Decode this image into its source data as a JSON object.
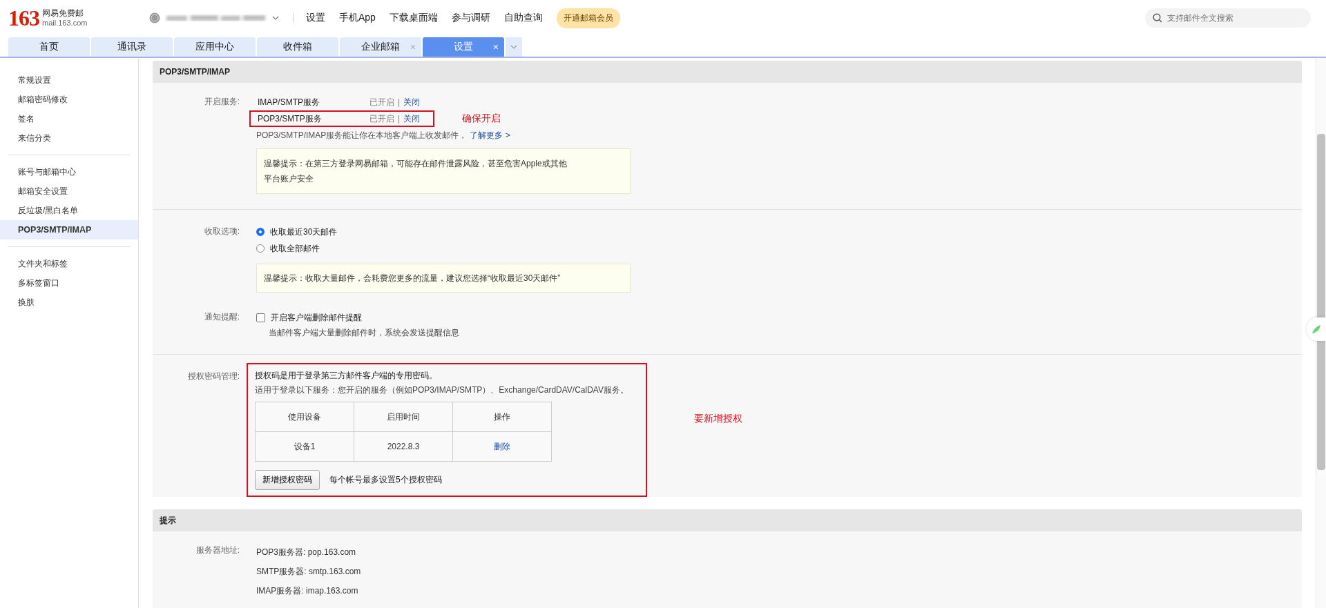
{
  "header": {
    "logo": {
      "number": "163",
      "name": "网易免费邮",
      "domain": "mail.163.com"
    },
    "nav_links": [
      "设置",
      "手机App",
      "下载桌面端",
      "参与调研",
      "自助查询"
    ],
    "vip_button": "开通邮箱会员",
    "search": {
      "placeholder": "支持邮件全文搜索"
    }
  },
  "tabs": [
    {
      "label": "首页",
      "selected": false,
      "closable": false
    },
    {
      "label": "通讯录",
      "selected": false,
      "closable": false
    },
    {
      "label": "应用中心",
      "selected": false,
      "closable": false
    },
    {
      "label": "收件箱",
      "selected": false,
      "closable": false
    },
    {
      "label": "企业邮箱",
      "selected": false,
      "closable": true
    },
    {
      "label": "设置",
      "selected": true,
      "closable": true
    }
  ],
  "tab_close": "×",
  "sidebar": {
    "groups": [
      [
        {
          "label": "常规设置",
          "selected": false
        },
        {
          "label": "邮箱密码修改",
          "selected": false
        },
        {
          "label": "签名",
          "selected": false
        },
        {
          "label": "来信分类",
          "selected": false
        }
      ],
      [
        {
          "label": "账号与邮箱中心",
          "selected": false
        },
        {
          "label": "邮箱安全设置",
          "selected": false
        },
        {
          "label": "反垃圾/黑白名单",
          "selected": false
        },
        {
          "label": "POP3/SMTP/IMAP",
          "selected": true
        }
      ],
      [
        {
          "label": "文件夹和标签",
          "selected": false
        },
        {
          "label": "多标签窗口",
          "selected": false
        },
        {
          "label": "换肤",
          "selected": false
        }
      ]
    ]
  },
  "settings": {
    "title": "POP3/SMTP/IMAP",
    "services": {
      "label": "开启服务:",
      "items": [
        {
          "name": "IMAP/SMTP服务",
          "status": "已开启",
          "separator": "|",
          "action": "关闭",
          "highlighted": false
        },
        {
          "name": "POP3/SMTP服务",
          "status": "已开启",
          "separator": "|",
          "action": "关闭",
          "highlighted": true
        }
      ],
      "annotation": "确保开启",
      "description": "POP3/SMTP/IMAP服务能让你在本地客户端上收发邮件，",
      "learn_more": "了解更多 >",
      "tip_lines": [
        "温馨提示：在第三方登录网易邮箱，可能存在邮件泄露风险，甚至危害Apple或其他",
        "平台账户安全"
      ]
    },
    "fetch": {
      "label": "收取选项:",
      "options": [
        {
          "label": "收取最近30天邮件",
          "selected": true
        },
        {
          "label": "收取全部邮件",
          "selected": false
        }
      ],
      "tip": "温馨提示：收取大量邮件，会耗费您更多的流量，建议您选择“收取最近30天邮件”"
    },
    "notify": {
      "label": "通知提醒:",
      "checkbox": {
        "label": "开启客户端删除邮件提醒",
        "checked": false
      },
      "hint": "当邮件客户端大量删除邮件时，系统会发送提醒信息"
    },
    "auth": {
      "label": "授权密码管理:",
      "intro": "授权码是用于登录第三方邮件客户端的专用密码。",
      "scope": "适用于登录以下服务：您开启的服务（例如POP3/IMAP/SMTP）、Exchange/CardDAV/CalDAV服务。",
      "table": {
        "columns": [
          "使用设备",
          "启用时间",
          "操作"
        ],
        "rows": [
          {
            "device": "设备1",
            "time": "2022.8.3",
            "action": "删除"
          }
        ]
      },
      "add_button": "新增授权密码",
      "limit_note": "每个帐号最多设置5个授权密码",
      "annotation": "要新增授权"
    }
  },
  "tips": {
    "title": "提示",
    "label": "服务器地址:",
    "servers": [
      "POP3服务器: pop.163.com",
      "SMTP服务器: smtp.163.com",
      "IMAP服务器: imap.163.com"
    ]
  }
}
